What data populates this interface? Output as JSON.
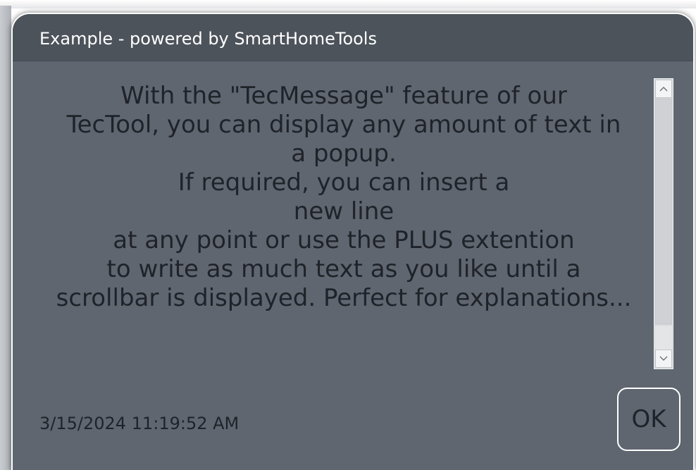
{
  "dialog": {
    "title": "Example - powered by SmartHomeTools",
    "message_lines": [
      "With the \"TecMessage\" feature of our",
      "TecTool, you can display any amount of text in",
      "a popup.",
      "If required, you can insert a",
      "new line",
      "at any point or use the PLUS extention",
      "to write as much text as you like until a",
      "scrollbar is displayed. Perfect for explanations..."
    ],
    "timestamp": "3/15/2024 11:19:52 AM",
    "ok_label": "OK",
    "scroll_up_icon": "chevron-up-icon",
    "scroll_down_icon": "chevron-down-icon"
  },
  "colors": {
    "dialog_background": "#5f6670",
    "title_bar_background": "#4d535b",
    "title_text": "#ffffff",
    "body_text": "#1f2329",
    "border": "#ffffff"
  }
}
